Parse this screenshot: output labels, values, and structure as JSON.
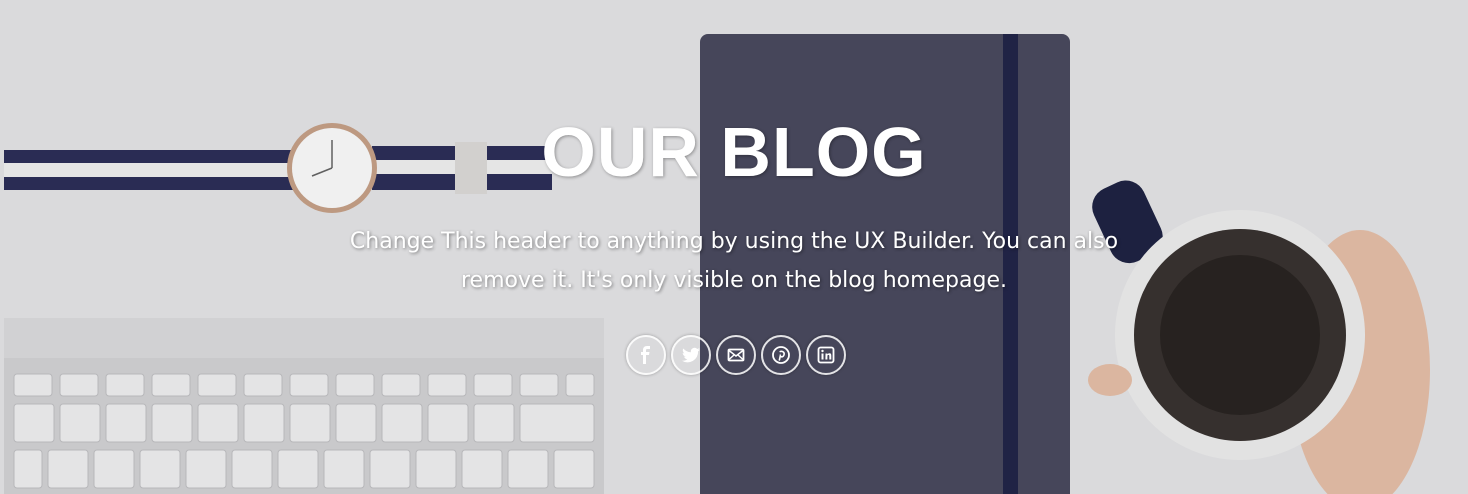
{
  "header": {
    "title": "OUR BLOG",
    "subtitle_line1": "Change This header to anything by using the UX Builder. You can also",
    "subtitle_line2": "remove it. It's only visible on the blog homepage."
  },
  "share_icons": [
    "facebook-icon",
    "twitter-icon",
    "email-icon",
    "pinterest-icon",
    "linkedin-icon"
  ],
  "colors": {
    "background": "#e9e9eb",
    "notebook": "#4a4a5e",
    "text": "#ffffff"
  }
}
